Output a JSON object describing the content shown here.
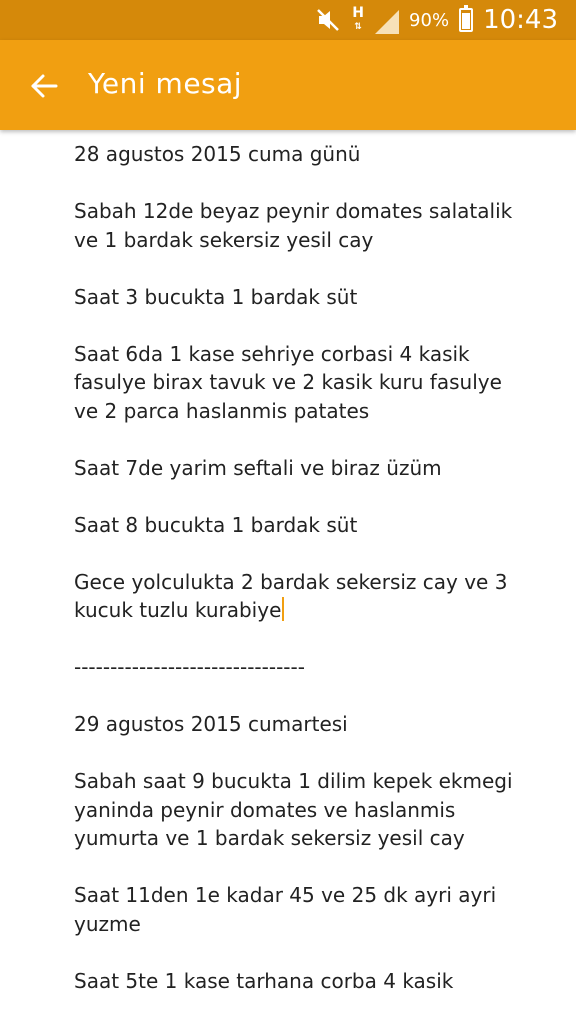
{
  "status_bar": {
    "hd_label": "H",
    "battery_percent": "90%",
    "battery_level": 0.9,
    "time": "10:43",
    "icons": [
      "mute-icon",
      "hd-icon",
      "signal-icon",
      "battery-icon"
    ]
  },
  "app_bar": {
    "title": "Yeni mesaj",
    "back_icon": "arrow-back-icon",
    "color": "#f19f11",
    "status_color": "#d5890a"
  },
  "message": {
    "lines": [
      "28 agustos 2015 cuma günü",
      "Sabah 12de beyaz peynir domates salatalik ve 1 bardak sekersiz yesil cay",
      "Saat 3 bucukta 1 bardak süt",
      "Saat 6da 1 kase sehriye corbasi 4 kasik fasulye birax tavuk ve 2 kasik kuru fasulye ve 2 parca haslanmis patates",
      "Saat 7de yarim seftali ve biraz üzüm",
      "Saat 8 bucukta 1 bardak süt",
      "Gece yolculukta 2 bardak sekersiz cay ve 3 kucuk tuzlu kurabiye",
      "--------------------------------",
      "29 agustos 2015 cumartesi",
      "Sabah saat 9 bucukta 1 dilim kepek ekmegi yaninda peynir domates ve haslanmis yumurta ve 1 bardak sekersiz yesil cay",
      "Saat 11den 1e kadar 45 ve 25 dk ayri ayri yuzme",
      "Saat 5te 1 kase tarhana corba 4 kasik"
    ]
  }
}
